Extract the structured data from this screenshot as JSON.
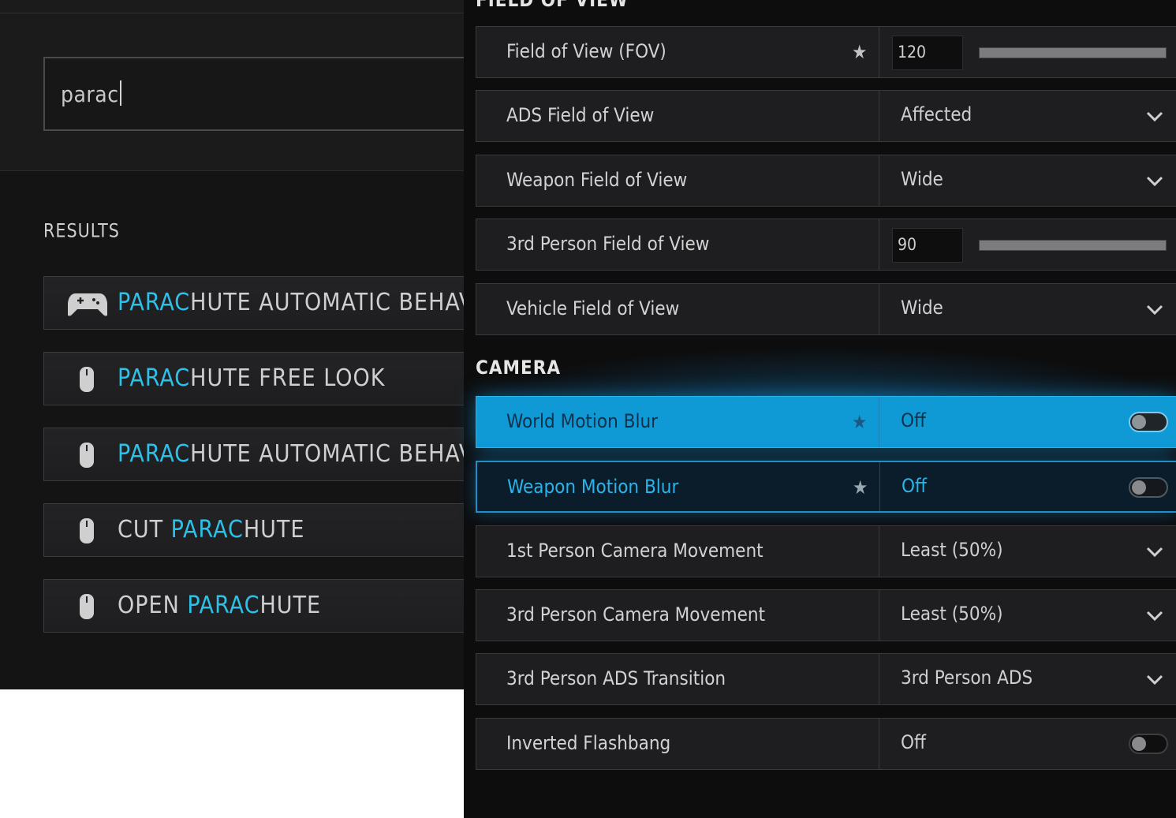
{
  "search": {
    "value": "parac"
  },
  "results": {
    "label": "RESULTS",
    "items": [
      {
        "icon": "gamepad-icon",
        "pre": "",
        "highlight": "PARAC",
        "post": "HUTE AUTOMATIC BEHAVIOR"
      },
      {
        "icon": "mouse-icon",
        "pre": "",
        "highlight": "PARAC",
        "post": "HUTE FREE LOOK"
      },
      {
        "icon": "mouse-icon",
        "pre": "",
        "highlight": "PARAC",
        "post": "HUTE AUTOMATIC BEHAVIOR"
      },
      {
        "icon": "mouse-icon",
        "pre": "CUT ",
        "highlight": "PARAC",
        "post": "HUTE"
      },
      {
        "icon": "mouse-icon",
        "pre": "OPEN ",
        "highlight": "PARAC",
        "post": "HUTE"
      }
    ]
  },
  "sections": {
    "fov_heading": "FIELD OF VIEW",
    "camera_heading": "CAMERA"
  },
  "settings": {
    "fov": {
      "label": "Field of View (FOV)",
      "value": "120",
      "slider_fraction": 1.0,
      "favorite": true
    },
    "ads_fov": {
      "label": "ADS Field of View",
      "value": "Affected"
    },
    "weapon_fov": {
      "label": "Weapon Field of View",
      "value": "Wide"
    },
    "third_fov": {
      "label": "3rd Person Field of View",
      "value": "90",
      "slider_fraction": 1.0
    },
    "vehicle_fov": {
      "label": "Vehicle Field of View",
      "value": "Wide"
    },
    "world_motion_blur": {
      "label": "World Motion Blur",
      "value": "Off",
      "favorite": true,
      "state": "selected"
    },
    "weapon_motion_blur": {
      "label": "Weapon Motion Blur",
      "value": "Off",
      "favorite": true,
      "state": "focused"
    },
    "first_camera_movement": {
      "label": "1st Person Camera Movement",
      "value": "Least (50%)"
    },
    "third_camera_movement": {
      "label": "3rd Person Camera Movement",
      "value": "Least (50%)"
    },
    "third_ads_transition": {
      "label": "3rd Person ADS Transition",
      "value": "3rd Person ADS"
    },
    "inverted_flashbang": {
      "label": "Inverted Flashbang",
      "value": "Off"
    }
  },
  "colors": {
    "accent": "#2cc1e8",
    "selected_row": "#0f9ad6"
  }
}
